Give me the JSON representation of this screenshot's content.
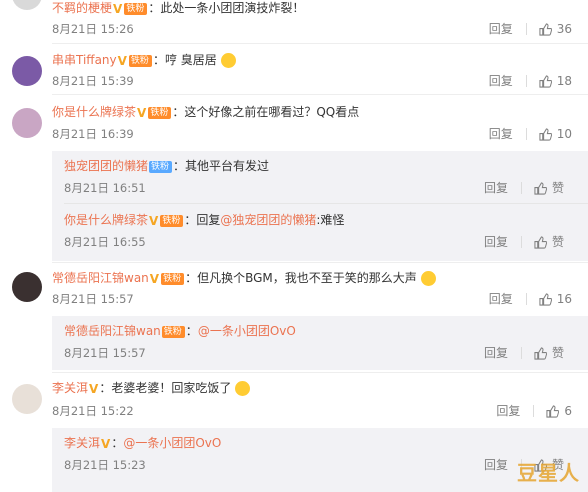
{
  "comments": [
    {
      "name": "不羁的梗梗",
      "text": "：此处一条小团团演技炸裂！",
      "time": "8月21日 15:26",
      "reply_label": "回复",
      "like_count": "36",
      "fan_badge": "铁粉"
    },
    {
      "name": "串串Tiffany",
      "text": "：哼 臭居居",
      "time": "8月21日 15:39",
      "reply_label": "回复",
      "like_count": "18",
      "fan_badge": "铁粉"
    },
    {
      "name": "你是什么牌绿茶",
      "text": "：这个好像之前在哪看过？QQ看点",
      "time": "8月21日 16:39",
      "reply_label": "回复",
      "like_count": "10",
      "fan_badge": "铁粉",
      "replies": [
        {
          "name": "独宠团团的懒猪",
          "text": "：其他平台有发过",
          "time": "8月21日 16:51",
          "reply_label": "回复",
          "like_label": "赞",
          "fan_badge": "铁粉"
        },
        {
          "name": "你是什么牌绿茶",
          "text_prefix": "：回复",
          "mention": "@独宠团团的懒猪",
          "text_suffix": ":难怪",
          "time": "8月21日 16:55",
          "reply_label": "回复",
          "like_label": "赞",
          "fan_badge": "铁粉"
        }
      ]
    },
    {
      "name": "常德岳阳江锦wan",
      "text": "：但凡换个BGM，我也不至于笑的那么大声",
      "time": "8月21日 15:57",
      "reply_label": "回复",
      "like_count": "16",
      "fan_badge": "铁粉",
      "replies": [
        {
          "name": "常德岳阳江锦wan",
          "text_prefix": "：",
          "mention": "@一条小团团OvO",
          "time": "8月21日 15:57",
          "reply_label": "回复",
          "like_label": "赞",
          "fan_badge": "铁粉"
        }
      ]
    },
    {
      "name": "李关洱",
      "text": "：老婆老婆！回家吃饭了",
      "time": "8月21日 15:22",
      "reply_label": "回复",
      "like_count": "6",
      "replies": [
        {
          "name": "李关洱",
          "text_prefix": "：",
          "mention": "@一条小团团OvO",
          "time": "8月21日 15:23",
          "reply_label": "回复",
          "like_label": "赞"
        }
      ]
    }
  ],
  "watermark": "豆星人",
  "colors": {
    "name": "#eb7350",
    "meta": "#808080",
    "reply_bg": "#f2f2f5"
  }
}
